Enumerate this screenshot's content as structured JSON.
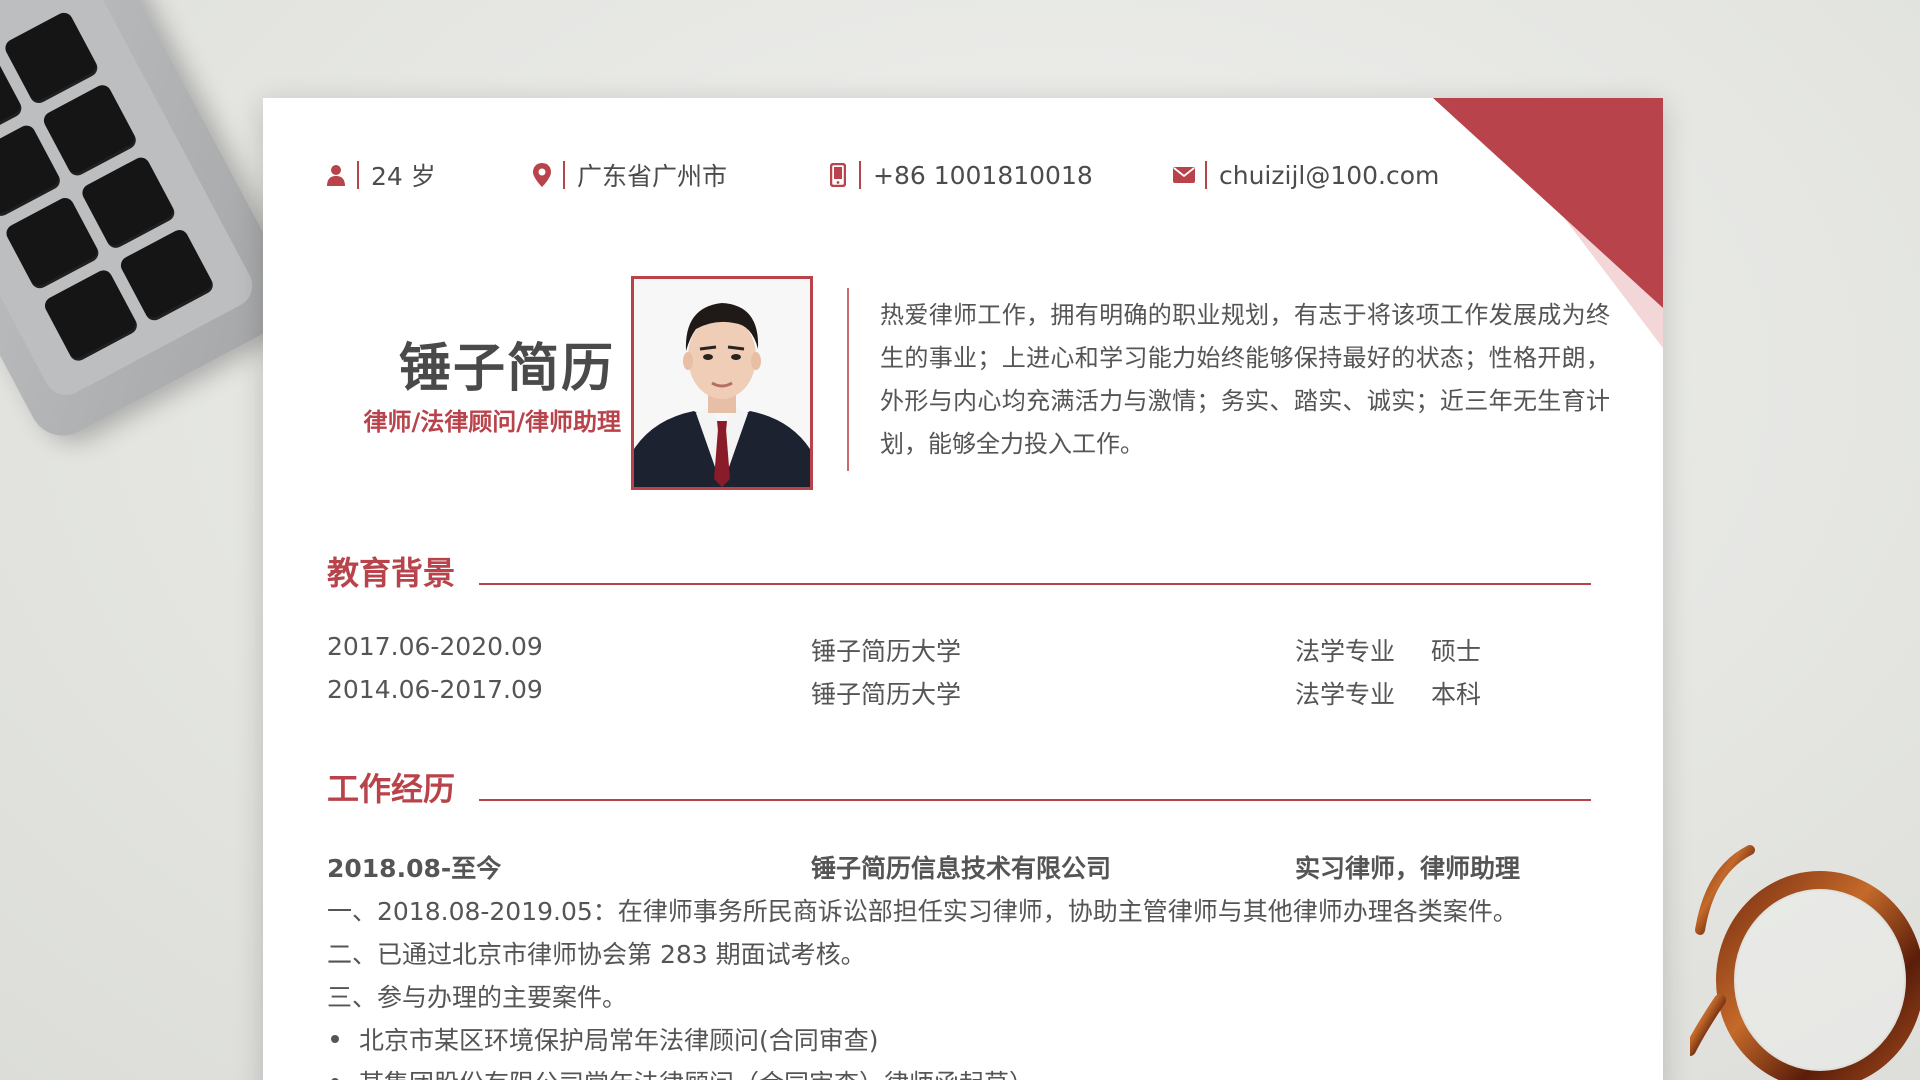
{
  "contact": {
    "age": "24 岁",
    "location": "广东省广州市",
    "phone": "+86 1001810018",
    "email": "chuizijl@100.com"
  },
  "profile": {
    "name": "锤子简历",
    "role": "律师/法律顾问/律师助理",
    "intro": "热爱律师工作，拥有明确的职业规划，有志于将该项工作发展成为终生的事业；上进心和学习能力始终能够保持最好的状态；性格开朗，外形与内心均充满活力与激情；务实、踏实、诚实；近三年无生育计划，能够全力投入工作。"
  },
  "education": {
    "title": "教育背景",
    "rows": [
      {
        "period": "2017.06-2020.09",
        "school": "锤子简历大学",
        "major": "法学专业",
        "degree": "硕士"
      },
      {
        "period": "2014.06-2017.09",
        "school": "锤子简历大学",
        "major": "法学专业",
        "degree": "本科"
      }
    ]
  },
  "work": {
    "title": "工作经历",
    "period": "2018.08-至今",
    "company": "锤子简历信息技术有限公司",
    "position": "实习律师，律师助理",
    "lines": [
      "一、2018.08-2019.05：在律师事务所民商诉讼部担任实习律师，协助主管律师与其他律师办理各类案件。",
      "二、已通过北京市律师协会第 283 期面试考核。",
      "三、参与办理的主要案件。"
    ],
    "bullets": [
      "北京市某区环境保护局常年法律顾问(合同审查)",
      "某集团股份有限公司常年法律顾问（合同审查）律师函起草）"
    ]
  },
  "icons": [
    "person-icon",
    "location-pin-icon",
    "phone-icon",
    "mail-icon"
  ],
  "colors": {
    "accent": "#b8434a",
    "accent_light": "#f3d6d8",
    "text": "#555555"
  }
}
